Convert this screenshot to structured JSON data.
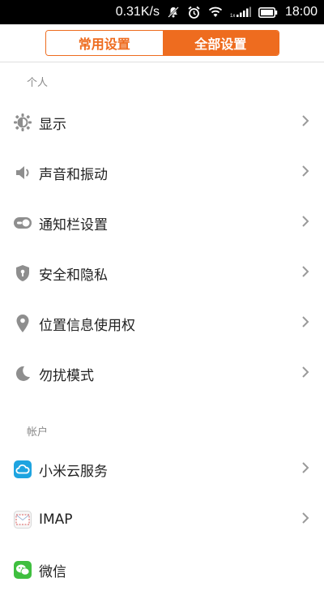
{
  "status_bar": {
    "speed": "0.31K/s",
    "time": "18:00",
    "icons": [
      "notification-muted-icon",
      "alarm-icon",
      "wifi-icon",
      "signal-icon",
      "battery-icon"
    ]
  },
  "tabs": [
    {
      "label": "常用设置",
      "active": false
    },
    {
      "label": "全部设置",
      "active": true
    }
  ],
  "sections": {
    "personal": {
      "header": "个人",
      "items": [
        {
          "label": "显示",
          "icon": "brightness-icon"
        },
        {
          "label": "声音和振动",
          "icon": "sound-icon"
        },
        {
          "label": "通知栏设置",
          "icon": "toggle-icon"
        },
        {
          "label": "安全和隐私",
          "icon": "shield-icon"
        },
        {
          "label": "位置信息使用权",
          "icon": "location-pin-icon"
        },
        {
          "label": "勿扰模式",
          "icon": "moon-icon"
        }
      ]
    },
    "account": {
      "header": "帐户",
      "items": [
        {
          "label": "小米云服务",
          "icon": "cloud-icon"
        },
        {
          "label": "IMAP",
          "icon": "mail-icon"
        },
        {
          "label": "微信",
          "icon": "wechat-icon"
        }
      ]
    }
  },
  "colors": {
    "accent": "#ee6c1f",
    "icon_gray": "#8e8e8e",
    "cloud_blue": "#1ea4e0",
    "wechat_green": "#3fbf3f"
  }
}
